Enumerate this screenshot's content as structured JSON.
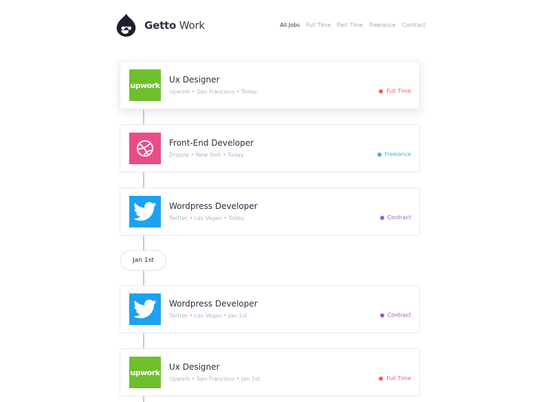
{
  "brand": {
    "name_bold": "Getto",
    "name_light": "Work",
    "logo_icon": "drupal-drop-icon"
  },
  "nav": {
    "items": [
      {
        "label": "All Jobs",
        "active": true
      },
      {
        "label": "Full Time",
        "active": false
      },
      {
        "label": "Part Time",
        "active": false
      },
      {
        "label": "Freelance",
        "active": false
      },
      {
        "label": "Contract",
        "active": false
      }
    ]
  },
  "colors": {
    "full_time": "#f25c5c",
    "freelance": "#3cb3e6",
    "contract": "#9b59d0",
    "upwork_green": "#6fbf2c",
    "dribbble_pink": "#ea4c89",
    "twitter_blue": "#1da1f2"
  },
  "jobs": [
    {
      "title": "Ux Designer",
      "meta": "Upwork • San Francisco • Today",
      "type": "Full Time",
      "logo": "upwork-logo",
      "logo_text": "upwork"
    },
    {
      "title": "Front-End Developer",
      "meta": "Dripple • New York • Today",
      "type": "Freelance",
      "logo": "dribbble-icon"
    },
    {
      "title": "Wordpress Developer",
      "meta": "Twitter • Las Vegas • Today",
      "type": "Contract",
      "logo": "twitter-bird-icon"
    },
    {
      "title": "Wordpress Developer",
      "meta": "Twitter • Las Vegas • Jan 1st",
      "type": "Contract",
      "logo": "twitter-bird-icon"
    },
    {
      "title": "Ux Designer",
      "meta": "Upwork • San Francisco • Jan 1st",
      "type": "Full Time",
      "logo": "upwork-logo",
      "logo_text": "upwork"
    }
  ],
  "date_separator": "Jan 1st"
}
